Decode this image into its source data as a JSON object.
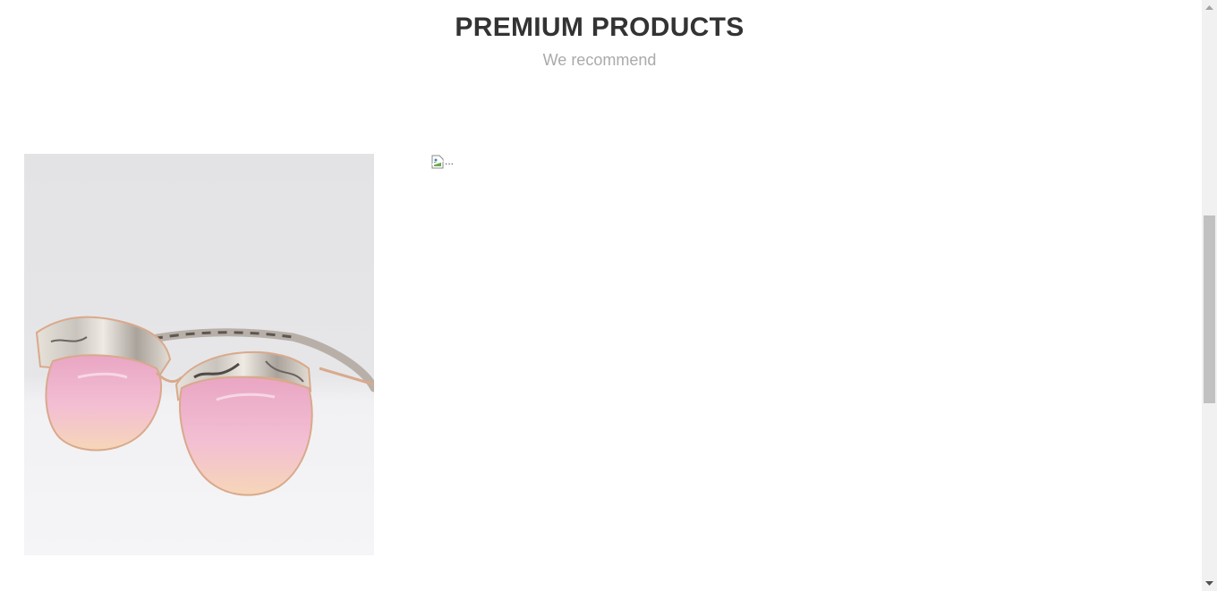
{
  "section": {
    "title": "PREMIUM PRODUCTS",
    "subtitle": "We recommend"
  },
  "products": [
    {
      "image_icon": "sunglasses-image"
    },
    {
      "image_alt": "...",
      "image_icon": "broken-image-icon"
    }
  ],
  "colors": {
    "title": "#333333",
    "subtitle": "#aaaaaa",
    "lens_pink": "#f2b8cc",
    "frame_gold": "#d9a98c",
    "scrollbar_thumb": "#c1c1c1"
  }
}
